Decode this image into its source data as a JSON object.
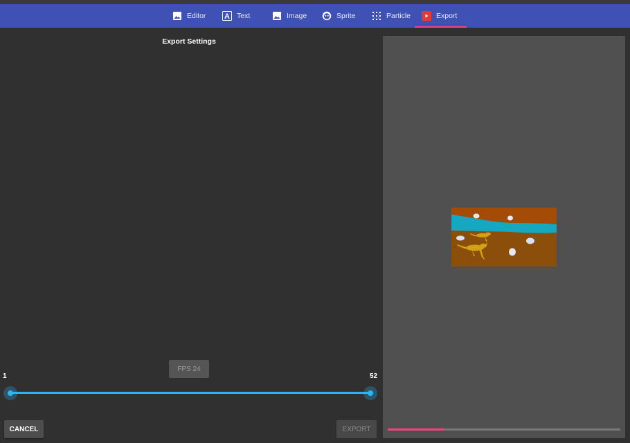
{
  "nav": {
    "tabs": [
      {
        "label": "Editor",
        "icon": "image-icon"
      },
      {
        "label": "Text",
        "icon": "text-icon"
      },
      {
        "label": "Image",
        "icon": "image-icon"
      },
      {
        "label": "Sprite",
        "icon": "sprite-icon"
      },
      {
        "label": "Particle",
        "icon": "particle-icon"
      },
      {
        "label": "Export",
        "icon": "export-icon",
        "active": true
      }
    ]
  },
  "export": {
    "title": "Export Settings",
    "fps_label": "FPS 24",
    "range_min": "1",
    "range_max": "52",
    "cancel_label": "CANCEL",
    "export_label": "EXPORT",
    "progress": 0.24
  },
  "colors": {
    "nav_bg": "#3f51b5",
    "accent": "#ff4081",
    "slider": "#29b6f6",
    "panel_bg": "#303030",
    "preview_bg": "#505050"
  }
}
